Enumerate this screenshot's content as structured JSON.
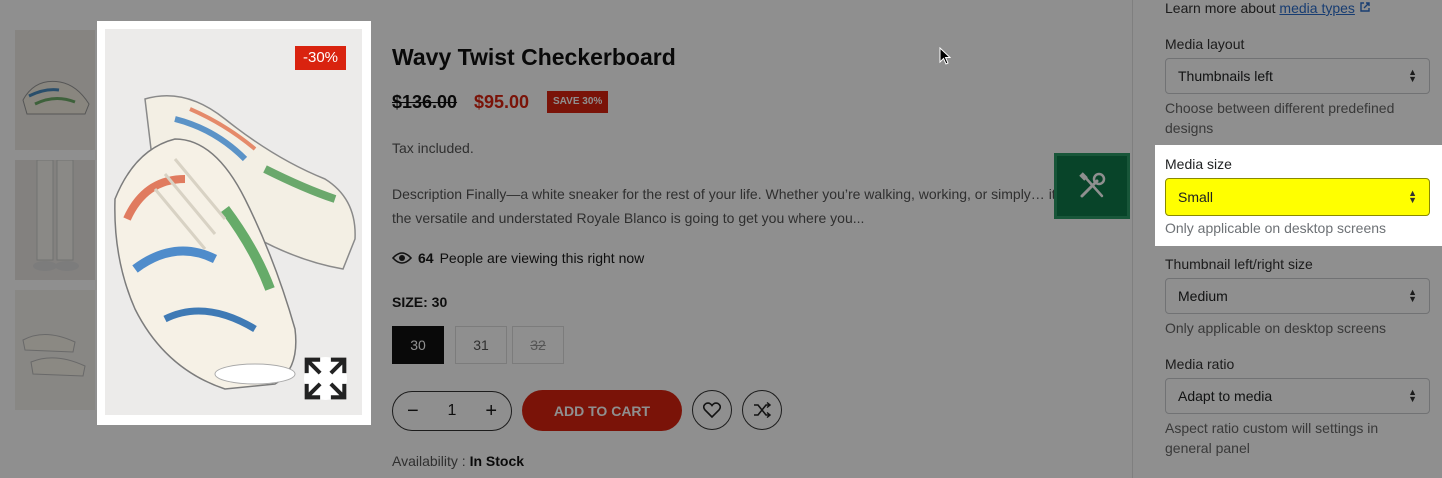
{
  "product": {
    "title": "Wavy Twist Checkerboard",
    "price_old": "$136.00",
    "price_new": "$95.00",
    "save_badge": "SAVE 30%",
    "discount_badge": "-30%",
    "tax_text": "Tax included.",
    "description": "Description Finally—a white sneaker for the rest of your life. Whether you’re walking, working, or simply… it, the versatile and understated Royale Blanco is going to get you where you...",
    "viewers_count": "64",
    "viewers_text": "People are viewing this right now",
    "size_label": "SIZE: 30",
    "sizes": [
      "30",
      "31",
      "32"
    ],
    "quantity": "1",
    "add_to_cart": "ADD TO CART",
    "availability_label": "Availability :",
    "availability_value": "In Stock"
  },
  "settings": {
    "learn_more_prefix": "Learn more about",
    "learn_more_link": "media types",
    "media_layout": {
      "label": "Media layout",
      "value": "Thumbnails left",
      "help": "Choose between different predefined designs"
    },
    "media_size": {
      "label": "Media size",
      "value": "Small",
      "help": "Only applicable on desktop screens"
    },
    "thumbnail_size": {
      "label": "Thumbnail left/right size",
      "value": "Medium",
      "help": "Only applicable on desktop screens"
    },
    "media_ratio": {
      "label": "Media ratio",
      "value": "Adapt to media",
      "help": "Aspect ratio custom will settings in general panel"
    }
  },
  "colors": {
    "accent_red": "#d9230f",
    "highlight_yellow": "#ffff00",
    "fab_green": "#0f7a4a",
    "link_blue": "#2c6ecb"
  },
  "icons": [
    "expand-icon",
    "eye-icon",
    "minus-icon",
    "plus-icon",
    "heart-icon",
    "compare-icon",
    "tools-icon",
    "external-link-icon",
    "cursor-icon",
    "select-arrows-icon"
  ]
}
